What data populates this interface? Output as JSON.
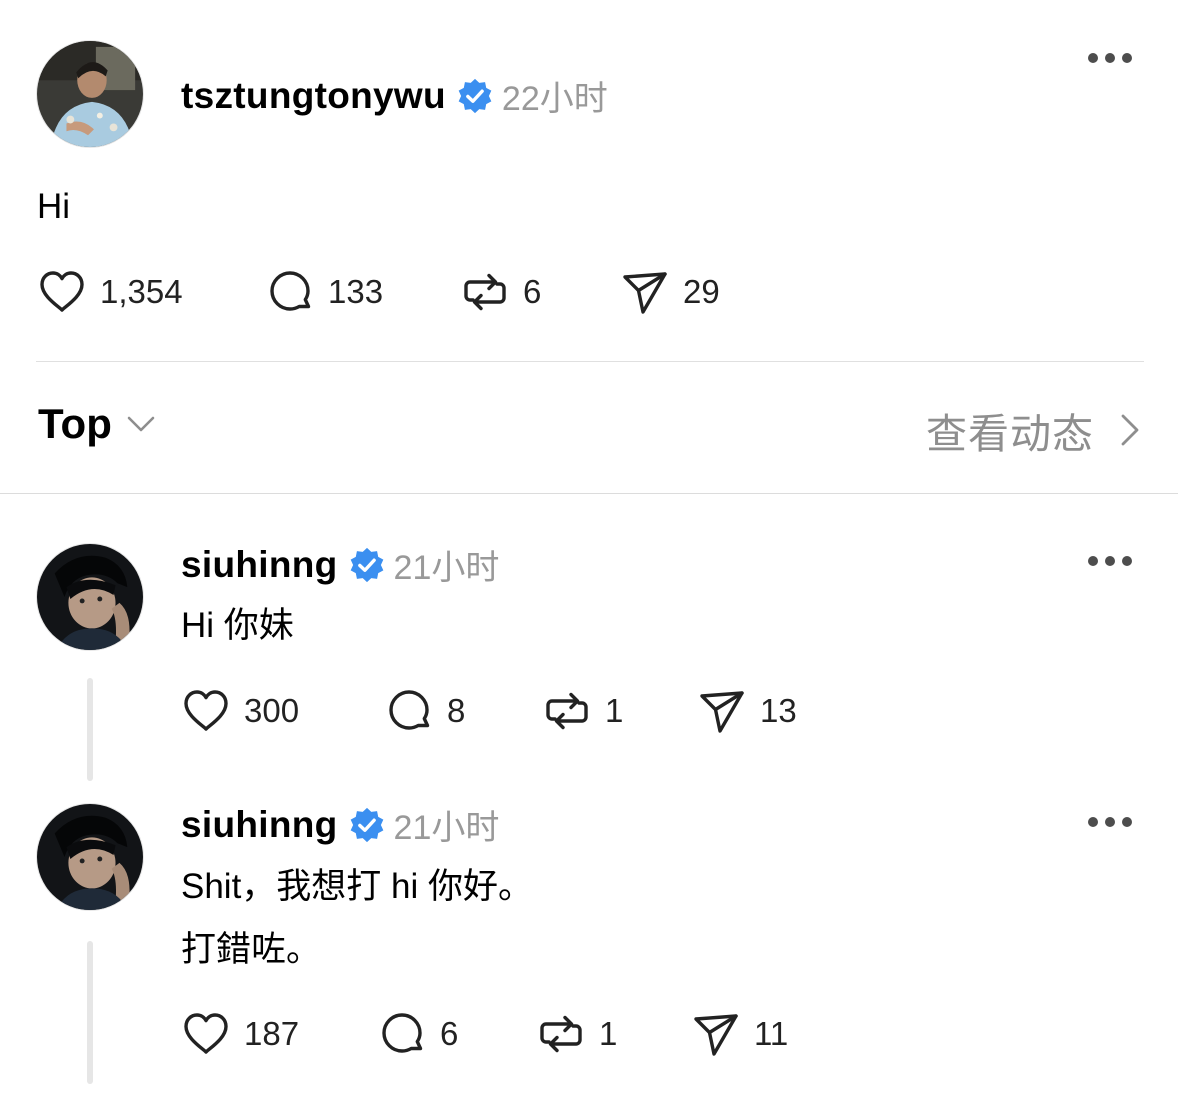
{
  "main_post": {
    "username": "tsztungtonywu",
    "time": "22小时",
    "text": "Hi",
    "likes": "1,354",
    "replies": "133",
    "reposts": "6",
    "shares": "29"
  },
  "sort_bar": {
    "label": "Top",
    "activity_label": "查看动态"
  },
  "replies": [
    {
      "username": "siuhinng",
      "time": "21小时",
      "lines": [
        "Hi 你妹"
      ],
      "likes": "300",
      "replies": "8",
      "reposts": "1",
      "shares": "13"
    },
    {
      "username": "siuhinng",
      "time": "21小时",
      "lines": [
        "Shit，我想打 hi 你好。",
        "打錯咗。"
      ],
      "likes": "187",
      "replies": "6",
      "reposts": "1",
      "shares": "11"
    }
  ],
  "colors": {
    "verified_badge": "#3b8ff0",
    "secondary_text": "#999999",
    "divider": "#e0e0e0"
  },
  "icons": [
    "heart-icon",
    "comment-icon",
    "repost-icon",
    "share-icon",
    "verified-badge-icon",
    "more-icon",
    "chevron-down-icon",
    "chevron-right-icon"
  ]
}
